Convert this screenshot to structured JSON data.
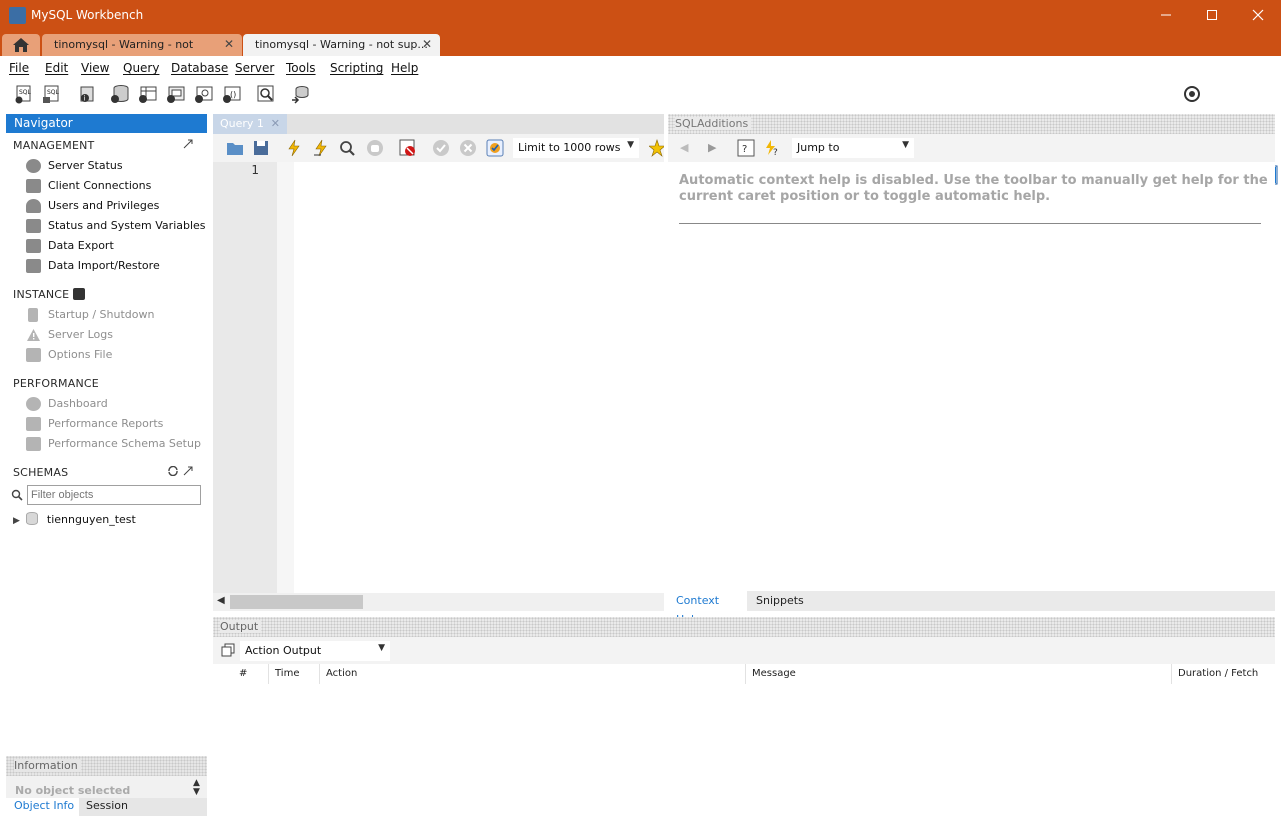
{
  "window": {
    "title": "MySQL Workbench"
  },
  "tabs": [
    {
      "label": "tinomysql - Warning - not supported"
    },
    {
      "label": "tinomysql - Warning - not sup..."
    }
  ],
  "menu": [
    "File",
    "Edit",
    "View",
    "Query",
    "Database",
    "Server",
    "Tools",
    "Scripting",
    "Help"
  ],
  "navigator": {
    "title": "Navigator",
    "management": {
      "label": "MANAGEMENT",
      "items": [
        "Server Status",
        "Client Connections",
        "Users and Privileges",
        "Status and System Variables",
        "Data Export",
        "Data Import/Restore"
      ]
    },
    "instance": {
      "label": "INSTANCE",
      "items": [
        "Startup / Shutdown",
        "Server Logs",
        "Options File"
      ]
    },
    "performance": {
      "label": "PERFORMANCE",
      "items": [
        "Dashboard",
        "Performance Reports",
        "Performance Schema Setup"
      ]
    },
    "schemas": {
      "label": "SCHEMAS",
      "filter_placeholder": "Filter objects",
      "items": [
        "tiennguyen_test"
      ]
    }
  },
  "information": {
    "title": "Information",
    "empty_text": "No object selected",
    "tabs": [
      "Object Info",
      "Session"
    ]
  },
  "query": {
    "tab_label": "Query 1",
    "limit_label": "Limit to 1000 rows",
    "line_numbers": [
      "1"
    ]
  },
  "sql_additions": {
    "title": "SQLAdditions",
    "jump_label": "Jump to",
    "help_text": "Automatic context help is disabled. Use the toolbar to manually get help for the current caret position or to toggle automatic help.",
    "tabs": [
      "Context Help",
      "Snippets"
    ]
  },
  "output": {
    "title": "Output",
    "mode_label": "Action Output",
    "columns": [
      "#",
      "Time",
      "Action",
      "Message",
      "Duration / Fetch"
    ]
  },
  "colors": {
    "titlebar": "#cc5014",
    "navigator_header": "#1e7ad1",
    "link_blue": "#1e7ad1"
  }
}
